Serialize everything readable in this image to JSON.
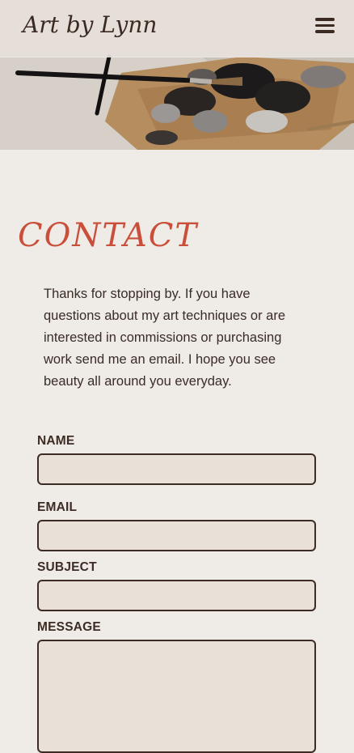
{
  "header": {
    "brand": "Art by Lynn",
    "menu_icon": "hamburger-menu-icon"
  },
  "main": {
    "title": "CONTACT",
    "intro": "Thanks for stopping by. If you have questions about my art techniques or are interested in commissions or purchasing work send me an email. I hope you see beauty all around you everyday."
  },
  "form": {
    "name": {
      "label": "NAME",
      "value": ""
    },
    "email": {
      "label": "EMAIL",
      "value": ""
    },
    "subject": {
      "label": "SUBJECT",
      "value": ""
    },
    "message": {
      "label": "MESSAGE",
      "value": ""
    }
  },
  "colors": {
    "background": "#efebe6",
    "accent": "#c94f3a",
    "text": "#3d2c25",
    "input_fill": "#e9e0d8"
  }
}
